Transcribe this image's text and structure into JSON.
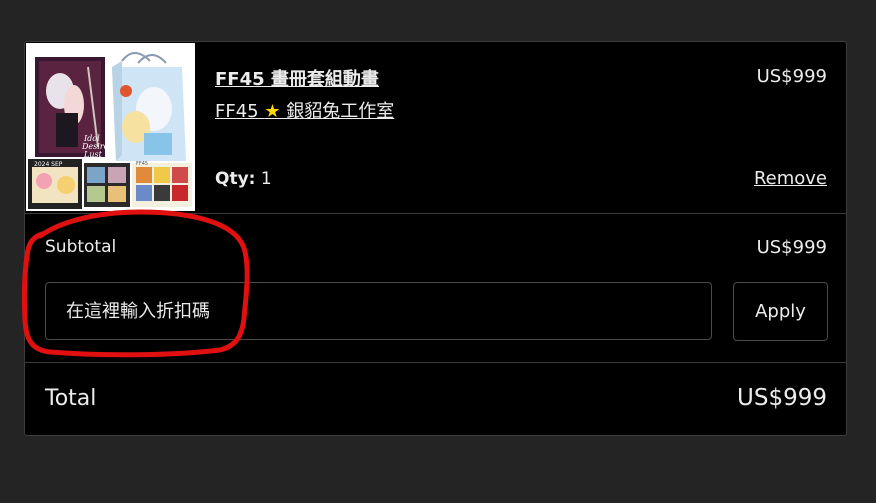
{
  "cart": {
    "item": {
      "name": "FF45 畫冊套組動畫",
      "seller_prefix": "FF45 ",
      "seller_star": "★",
      "seller_name": " 銀貂兔工作室",
      "price": "US$999",
      "qty_label": "Qty:",
      "qty_value": "1",
      "remove_label": "Remove",
      "thumbnail_texts": [
        "Idol",
        "Desire",
        "Lust",
        "2024 SEP",
        "FF45"
      ]
    },
    "subtotal": {
      "label": "Subtotal",
      "value": "US$999"
    },
    "discount": {
      "placeholder": "在這裡輸入折扣碼",
      "value": "",
      "apply_label": "Apply"
    },
    "total": {
      "label": "Total",
      "value": "US$999"
    }
  },
  "colors": {
    "page_bg": "#242424",
    "card_bg": "#000000",
    "text": "#ececec",
    "star": "#ffd800",
    "annotation_red": "#e01010"
  }
}
